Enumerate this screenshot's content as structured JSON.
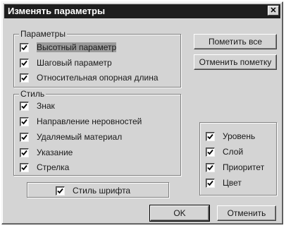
{
  "dialog": {
    "title": "Изменять параметры",
    "close_glyph": "✕"
  },
  "params_group": {
    "legend": "Параметры",
    "items": [
      {
        "label": "Высотный параметр",
        "checked": true
      },
      {
        "label": "Шаговый параметр",
        "checked": true
      },
      {
        "label": "Относительная опорная длина",
        "checked": true
      }
    ]
  },
  "style_group": {
    "legend": "Стиль",
    "items": [
      {
        "label": "Знак",
        "checked": true
      },
      {
        "label": "Направление неровностей",
        "checked": true
      },
      {
        "label": "Удаляемый материал",
        "checked": true
      },
      {
        "label": "Указание",
        "checked": true
      },
      {
        "label": "Стрелка",
        "checked": true
      }
    ]
  },
  "font_style": {
    "label": "Стиль шрифта",
    "checked": true
  },
  "layer_group": {
    "items": [
      {
        "label": "Уровень",
        "checked": true
      },
      {
        "label": "Слой",
        "checked": true
      },
      {
        "label": "Приоритет",
        "checked": true
      },
      {
        "label": "Цвет",
        "checked": true
      }
    ]
  },
  "buttons": {
    "mark_all": "Пометить все",
    "unmark": "Отменить пометку",
    "ok": "OK",
    "cancel": "Отменить"
  },
  "colors": {
    "face": "#d4d4d4",
    "titlebar": "#1e1e1e",
    "title_text": "#ffffff"
  },
  "icons": {
    "checkbox_mark": "checkmark-icon",
    "close": "close-icon"
  }
}
